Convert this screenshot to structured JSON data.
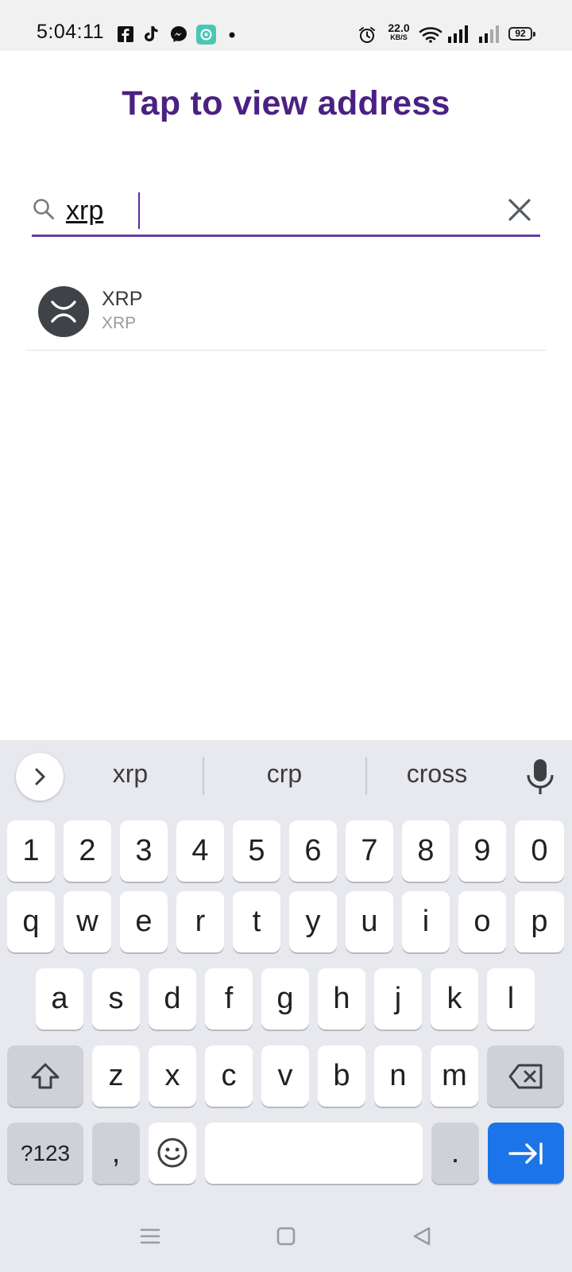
{
  "status_bar": {
    "time": "5:04:11",
    "net_speed_value": "22.0",
    "net_speed_unit": "KB/S",
    "battery": "92",
    "icons": [
      "facebook-icon",
      "tiktok-icon",
      "messenger-icon",
      "app-icon",
      "dot-icon",
      "alarm-icon",
      "wifi-icon",
      "signal-icon",
      "signal-weak-icon",
      "battery-icon"
    ]
  },
  "header": {
    "title": "Tap to view address"
  },
  "search": {
    "value": "xrp",
    "clear_icon": "close-icon",
    "search_icon": "search-icon",
    "accent": "#6a3aa3"
  },
  "results": [
    {
      "name": "XRP",
      "symbol": "XRP",
      "icon": "xrp-logo-icon"
    }
  ],
  "keyboard": {
    "suggestions": [
      "xrp",
      "crp",
      "cross"
    ],
    "row_numbers": [
      "1",
      "2",
      "3",
      "4",
      "5",
      "6",
      "7",
      "8",
      "9",
      "0"
    ],
    "row1": [
      "q",
      "w",
      "e",
      "r",
      "t",
      "y",
      "u",
      "i",
      "o",
      "p"
    ],
    "row2": [
      "a",
      "s",
      "d",
      "f",
      "g",
      "h",
      "j",
      "k",
      "l"
    ],
    "row3": [
      "z",
      "x",
      "c",
      "v",
      "b",
      "n",
      "m"
    ],
    "symbols_label": "?123",
    "comma_label": ",",
    "period_label": ".",
    "enter_color": "#1b74e8"
  },
  "nav_bar": {
    "icons": [
      "menu-icon",
      "home-icon",
      "back-icon"
    ]
  }
}
